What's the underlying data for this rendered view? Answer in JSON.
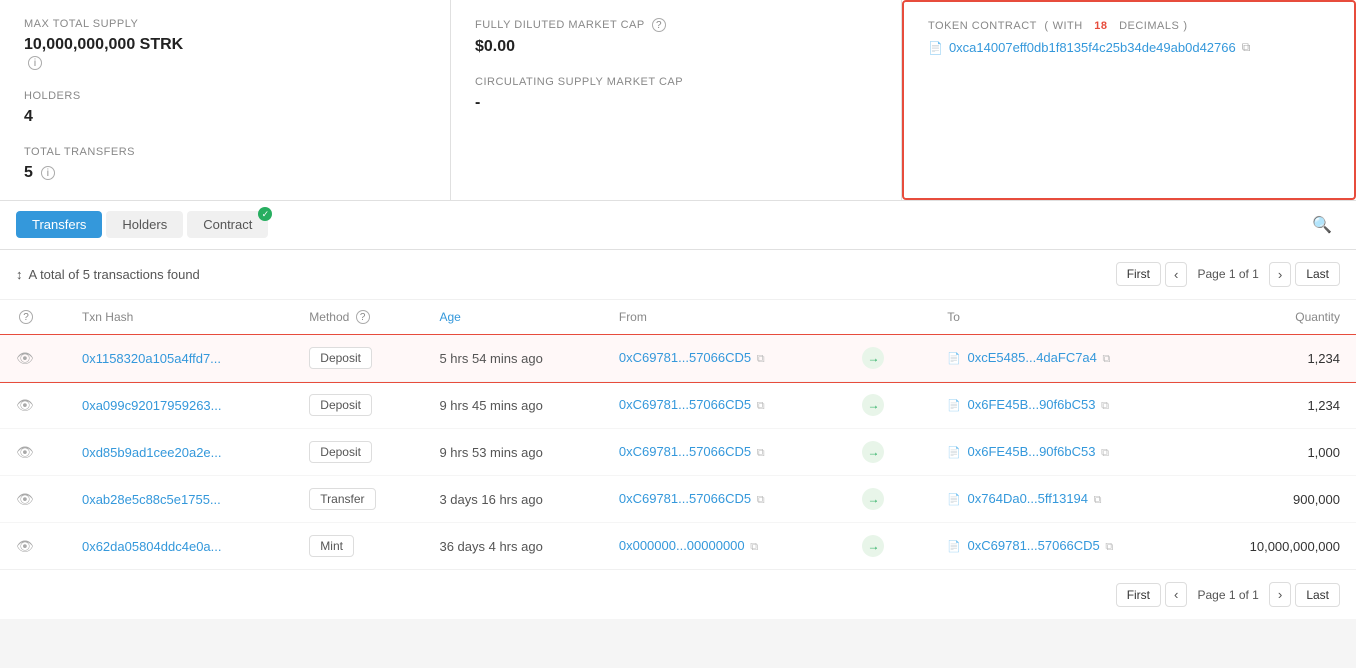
{
  "stats": {
    "max_supply_label": "MAX TOTAL SUPPLY",
    "max_supply_value": "10,000,000,000 STRK",
    "max_supply_info": "i",
    "holders_label": "HOLDERS",
    "holders_value": "4",
    "transfers_label": "TOTAL TRANSFERS",
    "transfers_value": "5",
    "transfers_info": "i",
    "fully_diluted_label": "FULLY DILUTED MARKET CAP",
    "fully_diluted_info": "?",
    "fully_diluted_value": "$0.00",
    "circulating_label": "CIRCULATING SUPPLY MARKET CAP",
    "circulating_value": "-",
    "token_contract_label": "TOKEN CONTRACT",
    "token_contract_with": "WITH",
    "token_contract_decimals": "18",
    "token_contract_decimals_text": "DECIMALS",
    "token_contract_address": "0xca14007eff0db1f8135f4c25b34de49ab0d42766"
  },
  "tabs": {
    "transfers": "Transfers",
    "holders": "Holders",
    "contract": "Contract"
  },
  "table": {
    "tx_count_icon": "↕",
    "tx_count_text": "A total of 5 transactions found",
    "col_info": "?",
    "col_txhash": "Txn Hash",
    "col_method": "Method",
    "col_method_info": "?",
    "col_age": "Age",
    "col_from": "From",
    "col_to": "To",
    "col_quantity": "Quantity",
    "pagination_first": "First",
    "pagination_prev": "‹",
    "pagination_page": "Page 1 of 1",
    "pagination_next": "›",
    "pagination_last": "Last",
    "rows": [
      {
        "txhash": "0x1158320a105a4ffd7...",
        "method": "Deposit",
        "age": "5 hrs 54 mins ago",
        "from": "0xC69781...57066CD5",
        "to": "0xcE5485...4daFC7a4",
        "quantity": "1,234",
        "highlight": true
      },
      {
        "txhash": "0xa099c92017959263...",
        "method": "Deposit",
        "age": "9 hrs 45 mins ago",
        "from": "0xC69781...57066CD5",
        "to": "0x6FE45B...90f6bC53",
        "quantity": "1,234",
        "highlight": false
      },
      {
        "txhash": "0xd85b9ad1cee20a2e...",
        "method": "Deposit",
        "age": "9 hrs 53 mins ago",
        "from": "0xC69781...57066CD5",
        "to": "0x6FE45B...90f6bC53",
        "quantity": "1,000",
        "highlight": false
      },
      {
        "txhash": "0xab28e5c88c5e1755...",
        "method": "Transfer",
        "age": "3 days 16 hrs ago",
        "from": "0xC69781...57066CD5",
        "to": "0x764Da0...5ff13194",
        "quantity": "900,000",
        "highlight": false
      },
      {
        "txhash": "0x62da05804ddc4e0a...",
        "method": "Mint",
        "age": "36 days 4 hrs ago",
        "from": "0x000000...00000000",
        "to": "0xC69781...57066CD5",
        "quantity": "10,000,000,000",
        "highlight": false
      }
    ]
  }
}
